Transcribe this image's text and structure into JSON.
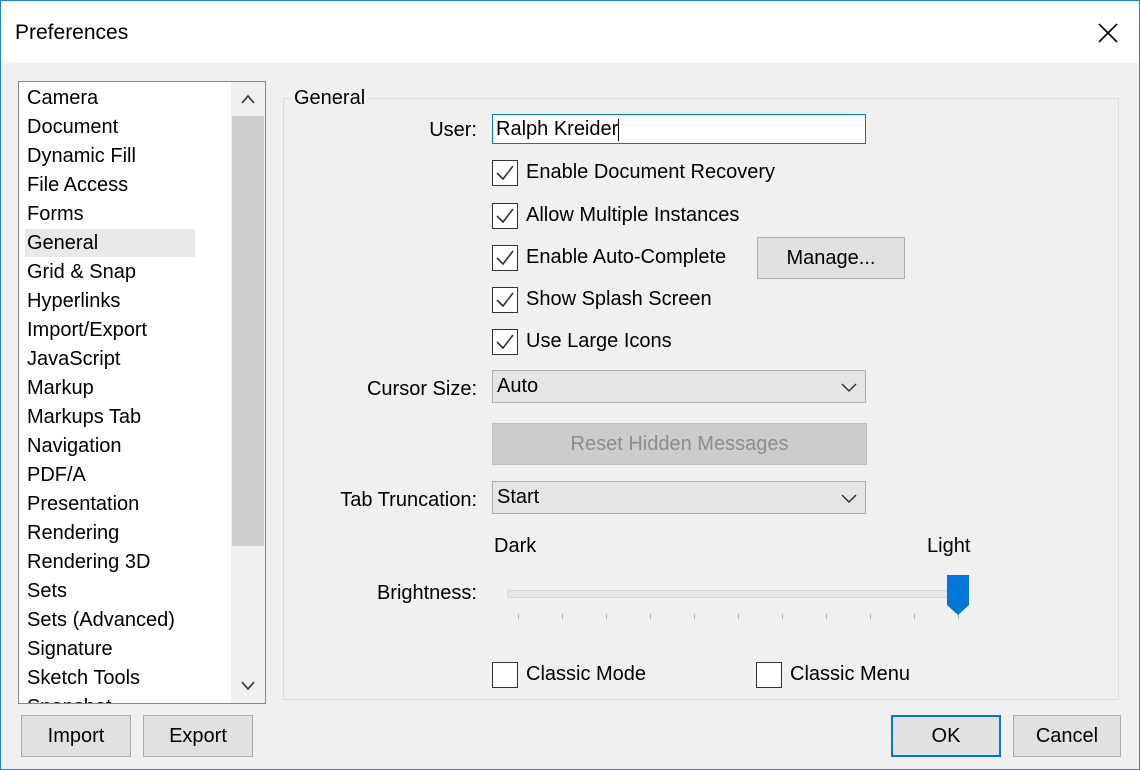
{
  "window": {
    "title": "Preferences"
  },
  "categories": {
    "items": [
      "Camera",
      "Document",
      "Dynamic Fill",
      "File Access",
      "Forms",
      "General",
      "Grid & Snap",
      "Hyperlinks",
      "Import/Export",
      "JavaScript",
      "Markup",
      "Markups Tab",
      "Navigation",
      "PDF/A",
      "Presentation",
      "Rendering",
      "Rendering 3D",
      "Sets",
      "Sets (Advanced)",
      "Signature",
      "Sketch Tools",
      "Snapshot"
    ],
    "selected": "General"
  },
  "general": {
    "group_label": "General",
    "user_label": "User:",
    "user_value": "Ralph Kreider",
    "checkboxes": [
      {
        "label": "Enable Document Recovery",
        "checked": true
      },
      {
        "label": "Allow Multiple Instances",
        "checked": true
      },
      {
        "label": "Enable Auto-Complete",
        "checked": true
      },
      {
        "label": "Show Splash Screen",
        "checked": true
      },
      {
        "label": "Use Large Icons",
        "checked": true
      }
    ],
    "manage_label": "Manage...",
    "cursor_size_label": "Cursor Size:",
    "cursor_size_value": "Auto",
    "reset_label": "Reset Hidden Messages",
    "tab_truncation_label": "Tab Truncation:",
    "tab_truncation_value": "Start",
    "slider": {
      "min_label": "Dark",
      "max_label": "Light",
      "label": "Brightness:",
      "value_fraction": 1.0
    },
    "classic_mode": {
      "label": "Classic Mode",
      "checked": false
    },
    "classic_menu": {
      "label": "Classic Menu",
      "checked": false
    }
  },
  "footer": {
    "import_label": "Import",
    "export_label": "Export",
    "ok_label": "OK",
    "cancel_label": "Cancel"
  },
  "colors": {
    "accent": "#0078d7",
    "selection": "#e8e8e8"
  }
}
